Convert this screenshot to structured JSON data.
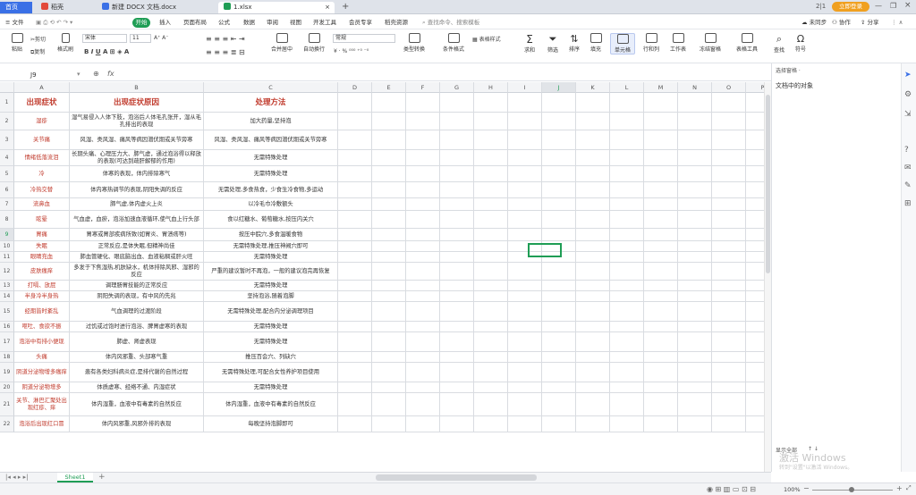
{
  "tabs": [
    {
      "label": "首页",
      "active": true
    },
    {
      "label": "稻壳"
    },
    {
      "label": "新建 DOCX 文档.docx"
    },
    {
      "label": "1.xlsx",
      "current": true
    }
  ],
  "title_right": {
    "page_no": "2|1",
    "login": "立即登录"
  },
  "menu": {
    "file": "文件",
    "items": [
      "开始",
      "插入",
      "页面布局",
      "公式",
      "数据",
      "审阅",
      "视图",
      "开发工具",
      "会员专享",
      "稻壳资源"
    ],
    "search": "查找命令、搜索模板",
    "right": [
      "未同步",
      "协作",
      "分享"
    ]
  },
  "ribbon": {
    "paste": "粘贴",
    "cut": "剪切",
    "copy": "复制",
    "format_painter": "格式刷",
    "font": "宋体",
    "size": "11",
    "merge": "合并居中",
    "wrap": "自动换行",
    "number_format": "常规",
    "convert": "类型转换",
    "cond_format": "条件格式",
    "cell_style": "表格样式",
    "sum": "求和",
    "filter": "筛选",
    "sort": "排序",
    "fill": "填充",
    "cell": "单元格",
    "row_col": "行和列",
    "sheet": "工作表",
    "freeze": "冻结窗格",
    "table_tools": "表格工具",
    "find": "查找",
    "symbol": "符号"
  },
  "formula_bar": {
    "name_box": "J9",
    "fx": "fx"
  },
  "columns": [
    "A",
    "B",
    "C",
    "D",
    "E",
    "F",
    "G",
    "H",
    "I",
    "J",
    "K",
    "L",
    "M",
    "N",
    "O",
    "P"
  ],
  "header_row": {
    "a": "出现症状",
    "b": "出现症状原因",
    "c": "处理方法"
  },
  "rows": [
    {
      "n": "2",
      "a": "湿疹",
      "b": "湿气易侵入人体下肢，泡浴后人体毛孔张开，湿从毛孔排出的表现",
      "c": "加大药量,坚持泡"
    },
    {
      "n": "3",
      "a": "关节痛",
      "b": "风湿、类风湿、痛风等病因潜伏期或关节旁寒",
      "c": "风湿、类风湿、痛风等病因潜伏期或关节旁寒"
    },
    {
      "n": "4",
      "a": "情绪低落流泪",
      "b": "长期头痛、心理压力大、肺气虚，通过泡浴得以释放的表现(可达到疏肝解郁的作用)",
      "c": "无需特殊处理"
    },
    {
      "n": "5",
      "a": "冷",
      "b": "体寒的表现，体内排除寒气",
      "c": "无需特殊处理"
    },
    {
      "n": "6",
      "a": "冷热交替",
      "b": "体内寒热调节的表现,阴阳失调的反应",
      "c": "无需处理,多食热食，少食生冷食物,多运动"
    },
    {
      "n": "7",
      "a": "流鼻血",
      "b": "肺气虚,体内虚火上炎",
      "c": "以冷毛巾冷敷额头"
    },
    {
      "n": "8",
      "a": "眩晕",
      "b": "气血虚，血瘀，泡浴加速血液循环,使气血上行头部",
      "c": "食以红糖水、葡萄糖水,按压内关穴"
    },
    {
      "n": "9",
      "a": "胃痛",
      "b": "胃寒或胃部疾病所致(如胃炎、胃溃疡等)",
      "c": "按压中脘穴,多食温暖食物"
    },
    {
      "n": "10",
      "a": "失眠",
      "b": "正常反应,是体失眠,但精神尚佳",
      "c": "无需特殊处理,推压神阙穴即可"
    },
    {
      "n": "11",
      "a": "眼睛充血",
      "b": "肺血管硬化、眼底脑出血、血液粘稠或肝火旺",
      "c": "无需特殊处理"
    },
    {
      "n": "12",
      "a": "皮肤瘙痒",
      "b": "多发于下焦湿热,机肤缺水，机体排除风邪、湿邪的反应",
      "c": "严重的建议暂时不再泡，一般的建议泡完再恢复"
    },
    {
      "n": "13",
      "a": "打嗝、放屁",
      "b": "调理肠胃技能的正常反应",
      "c": "无需特殊处理"
    },
    {
      "n": "14",
      "a": "半身冷半身热",
      "b": "阴阳失调的表现，有中风的先兆",
      "c": "坚持泡浴,随着泡脚"
    },
    {
      "n": "15",
      "a": "经期皆时紊乱",
      "b": "气血调理的过渡阶段",
      "c": "无需特殊处理,配合内分泌调理项目"
    },
    {
      "n": "16",
      "a": "呕吐、食欲不振",
      "b": "过饥或过饱时进行泡浴、脾胃虚寒的表现",
      "c": "无需特殊处理"
    },
    {
      "n": "17",
      "a": "泡浴中有排小便现",
      "b": "肺虚、肾虚表现",
      "c": "无需特殊处理"
    },
    {
      "n": "18",
      "a": "头痛",
      "b": "体内风邪重、头部寒气重",
      "c": "推压百会穴、列缺穴"
    },
    {
      "n": "19",
      "a": "阴道分泌物增多瘙痒",
      "b": "患有各类妇科病炎症,是排代谢的自然过程",
      "c": "无需特殊处理,可配合女性养护项目使用"
    },
    {
      "n": "20",
      "a": "阴道分泌物增多",
      "b": "体质虚寒、经络不通、内湿症状",
      "c": "无需特殊处理"
    },
    {
      "n": "21",
      "a": "关节、淋巴汇聚处出现红疹、痒",
      "b": "体内湿重，血液中有毒素的自然反应",
      "c": "体内湿重，血液中有毒素的自然反应"
    },
    {
      "n": "22",
      "a": "泡浴后出现红口冒",
      "b": "体内风邪重,风邪外排的表现",
      "c": "每晚坚持泡脚即可"
    }
  ],
  "right_panel": {
    "top_label": "选择窗格 ·",
    "title": "文档中的对象",
    "bottom_left": "显示全部",
    "watermark": "激活 Windows",
    "watermark_sub": "转到\"设置\"以激活 Windows。"
  },
  "sheet_tabs": {
    "sheet": "Sheet1"
  },
  "status": {
    "zoom": "100%"
  },
  "colors": {
    "accent": "#1f9d55",
    "red_text": "#c0392b",
    "login_bg": "#f0a020"
  }
}
